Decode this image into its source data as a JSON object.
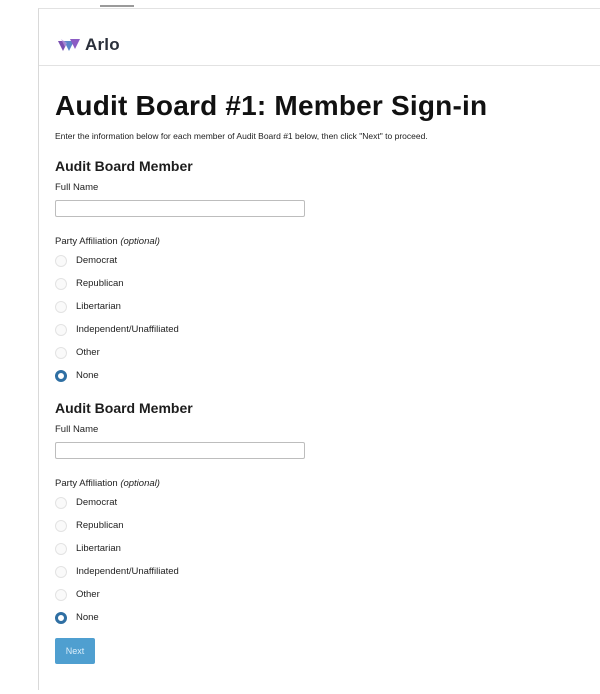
{
  "app": {
    "name": "Arlo"
  },
  "page": {
    "title": "Audit Board #1: Member Sign-in",
    "instructions": "Enter the information below for each member of Audit Board #1 below, then click \"Next\" to proceed."
  },
  "members": [
    {
      "section_title": "Audit Board Member",
      "name_label": "Full Name",
      "name_value": "",
      "party_label": "Party Affiliation",
      "party_optional": "(optional)",
      "options": [
        "Democrat",
        "Republican",
        "Libertarian",
        "Independent/Unaffiliated",
        "Other",
        "None"
      ],
      "selected": "None"
    },
    {
      "section_title": "Audit Board Member",
      "name_label": "Full Name",
      "name_value": "",
      "party_label": "Party Affiliation",
      "party_optional": "(optional)",
      "options": [
        "Democrat",
        "Republican",
        "Libertarian",
        "Independent/Unaffiliated",
        "Other",
        "None"
      ],
      "selected": "None"
    }
  ],
  "actions": {
    "next_label": "Next"
  },
  "colors": {
    "accent": "#2f6fa3",
    "button": "#4f9fd0"
  }
}
